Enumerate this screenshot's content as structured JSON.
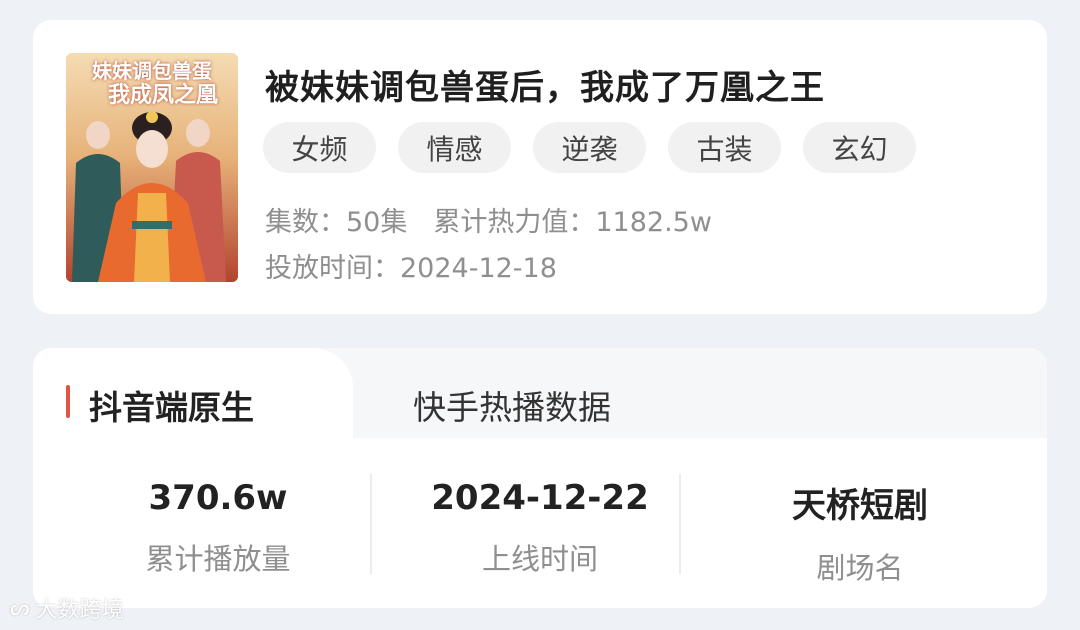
{
  "drama": {
    "title": "被妹妹调包兽蛋后，我成了万凰之王",
    "poster_text_line1": "妹妹调包兽蛋",
    "poster_text_line2": "我成凤之凰",
    "tags": [
      "女频",
      "情感",
      "逆袭",
      "古装",
      "玄幻"
    ],
    "episodes_label": "集数：",
    "episodes_value": "50集",
    "heat_label": "累计热力值：",
    "heat_value": "1182.5w",
    "release_label": "投放时间：",
    "release_value": "2024-12-18"
  },
  "tabs": {
    "active": "抖音端原生",
    "other": "快手热播数据"
  },
  "stats": [
    {
      "value": "370.6w",
      "label": "累计播放量"
    },
    {
      "value": "2024-12-22",
      "label": "上线时间"
    },
    {
      "value": "天桥短剧",
      "label": "剧场名"
    }
  ],
  "watermark": "大数跨境",
  "colors": {
    "accent": "#e05443",
    "tag_bg": "#f1f1f1",
    "page_bg": "#eef1f6"
  }
}
